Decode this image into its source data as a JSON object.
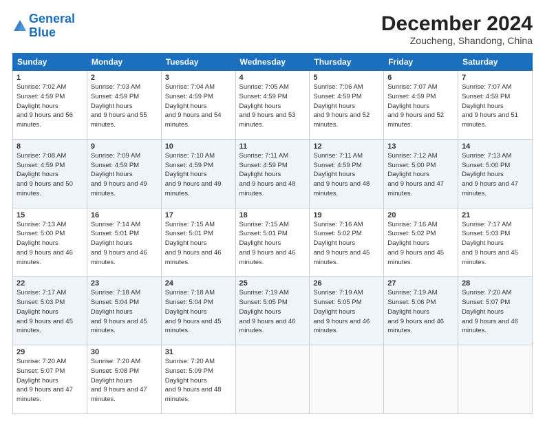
{
  "header": {
    "logo_line1": "General",
    "logo_line2": "Blue",
    "main_title": "December 2024",
    "subtitle": "Zoucheng, Shandong, China"
  },
  "columns": [
    "Sunday",
    "Monday",
    "Tuesday",
    "Wednesday",
    "Thursday",
    "Friday",
    "Saturday"
  ],
  "weeks": [
    [
      {
        "day": "1",
        "sunrise": "7:02 AM",
        "sunset": "4:59 PM",
        "daylight": "9 hours and 56 minutes."
      },
      {
        "day": "2",
        "sunrise": "7:03 AM",
        "sunset": "4:59 PM",
        "daylight": "9 hours and 55 minutes."
      },
      {
        "day": "3",
        "sunrise": "7:04 AM",
        "sunset": "4:59 PM",
        "daylight": "9 hours and 54 minutes."
      },
      {
        "day": "4",
        "sunrise": "7:05 AM",
        "sunset": "4:59 PM",
        "daylight": "9 hours and 53 minutes."
      },
      {
        "day": "5",
        "sunrise": "7:06 AM",
        "sunset": "4:59 PM",
        "daylight": "9 hours and 52 minutes."
      },
      {
        "day": "6",
        "sunrise": "7:07 AM",
        "sunset": "4:59 PM",
        "daylight": "9 hours and 52 minutes."
      },
      {
        "day": "7",
        "sunrise": "7:07 AM",
        "sunset": "4:59 PM",
        "daylight": "9 hours and 51 minutes."
      }
    ],
    [
      {
        "day": "8",
        "sunrise": "7:08 AM",
        "sunset": "4:59 PM",
        "daylight": "9 hours and 50 minutes."
      },
      {
        "day": "9",
        "sunrise": "7:09 AM",
        "sunset": "4:59 PM",
        "daylight": "9 hours and 49 minutes."
      },
      {
        "day": "10",
        "sunrise": "7:10 AM",
        "sunset": "4:59 PM",
        "daylight": "9 hours and 49 minutes."
      },
      {
        "day": "11",
        "sunrise": "7:11 AM",
        "sunset": "4:59 PM",
        "daylight": "9 hours and 48 minutes."
      },
      {
        "day": "12",
        "sunrise": "7:11 AM",
        "sunset": "4:59 PM",
        "daylight": "9 hours and 48 minutes."
      },
      {
        "day": "13",
        "sunrise": "7:12 AM",
        "sunset": "5:00 PM",
        "daylight": "9 hours and 47 minutes."
      },
      {
        "day": "14",
        "sunrise": "7:13 AM",
        "sunset": "5:00 PM",
        "daylight": "9 hours and 47 minutes."
      }
    ],
    [
      {
        "day": "15",
        "sunrise": "7:13 AM",
        "sunset": "5:00 PM",
        "daylight": "9 hours and 46 minutes."
      },
      {
        "day": "16",
        "sunrise": "7:14 AM",
        "sunset": "5:01 PM",
        "daylight": "9 hours and 46 minutes."
      },
      {
        "day": "17",
        "sunrise": "7:15 AM",
        "sunset": "5:01 PM",
        "daylight": "9 hours and 46 minutes."
      },
      {
        "day": "18",
        "sunrise": "7:15 AM",
        "sunset": "5:01 PM",
        "daylight": "9 hours and 46 minutes."
      },
      {
        "day": "19",
        "sunrise": "7:16 AM",
        "sunset": "5:02 PM",
        "daylight": "9 hours and 45 minutes."
      },
      {
        "day": "20",
        "sunrise": "7:16 AM",
        "sunset": "5:02 PM",
        "daylight": "9 hours and 45 minutes."
      },
      {
        "day": "21",
        "sunrise": "7:17 AM",
        "sunset": "5:03 PM",
        "daylight": "9 hours and 45 minutes."
      }
    ],
    [
      {
        "day": "22",
        "sunrise": "7:17 AM",
        "sunset": "5:03 PM",
        "daylight": "9 hours and 45 minutes."
      },
      {
        "day": "23",
        "sunrise": "7:18 AM",
        "sunset": "5:04 PM",
        "daylight": "9 hours and 45 minutes."
      },
      {
        "day": "24",
        "sunrise": "7:18 AM",
        "sunset": "5:04 PM",
        "daylight": "9 hours and 45 minutes."
      },
      {
        "day": "25",
        "sunrise": "7:19 AM",
        "sunset": "5:05 PM",
        "daylight": "9 hours and 46 minutes."
      },
      {
        "day": "26",
        "sunrise": "7:19 AM",
        "sunset": "5:05 PM",
        "daylight": "9 hours and 46 minutes."
      },
      {
        "day": "27",
        "sunrise": "7:19 AM",
        "sunset": "5:06 PM",
        "daylight": "9 hours and 46 minutes."
      },
      {
        "day": "28",
        "sunrise": "7:20 AM",
        "sunset": "5:07 PM",
        "daylight": "9 hours and 46 minutes."
      }
    ],
    [
      {
        "day": "29",
        "sunrise": "7:20 AM",
        "sunset": "5:07 PM",
        "daylight": "9 hours and 47 minutes."
      },
      {
        "day": "30",
        "sunrise": "7:20 AM",
        "sunset": "5:08 PM",
        "daylight": "9 hours and 47 minutes."
      },
      {
        "day": "31",
        "sunrise": "7:20 AM",
        "sunset": "5:09 PM",
        "daylight": "9 hours and 48 minutes."
      },
      null,
      null,
      null,
      null
    ]
  ]
}
